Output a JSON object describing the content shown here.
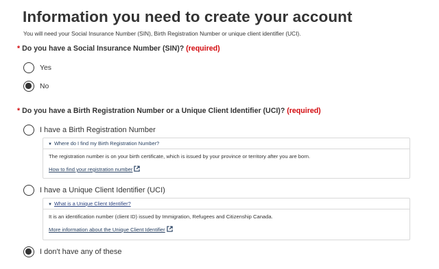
{
  "header": {
    "title": "Information you need to create your account",
    "intro": "You will need your Social Insurance Number (SIN), Birth Registration Number or unique client identifier (UCI)."
  },
  "question_sin": {
    "star": "*",
    "label": "Do you have a Social Insurance Number (SIN)?",
    "required": "(required)",
    "options": [
      {
        "label": "Yes",
        "selected": false
      },
      {
        "label": "No",
        "selected": true
      }
    ]
  },
  "question_brn": {
    "star": "*",
    "label": "Do you have a Birth Registration Number or a Unique Client Identifier (UCI)?",
    "required": "(required)",
    "options": [
      {
        "label": "I have a Birth Registration Number",
        "selected": false,
        "details": {
          "toggle_icon": "▼",
          "summary": "Where do I find my Birth Registration Number?",
          "body": "The registration number is on your birth certificate, which is issued by your province or territory after you are born.",
          "link": "How to find your registration number",
          "link_icon": "external-link-icon"
        }
      },
      {
        "label": "I have a Unique Client Identifier (UCI)",
        "selected": false,
        "details": {
          "toggle_icon": "▼",
          "summary": "What is a Unique Client Identifier?",
          "body": "It is an identification number (client ID) issued by Immigration, Refugees and Citizenship Canada.",
          "link": "More information about the Unique Client Identifier",
          "link_icon": "external-link-icon"
        }
      },
      {
        "label": "I don't have any of these",
        "selected": true
      }
    ]
  },
  "colors": {
    "text": "#333333",
    "required": "#d3080c",
    "link": "#284162",
    "border": "#d8d8d8"
  }
}
